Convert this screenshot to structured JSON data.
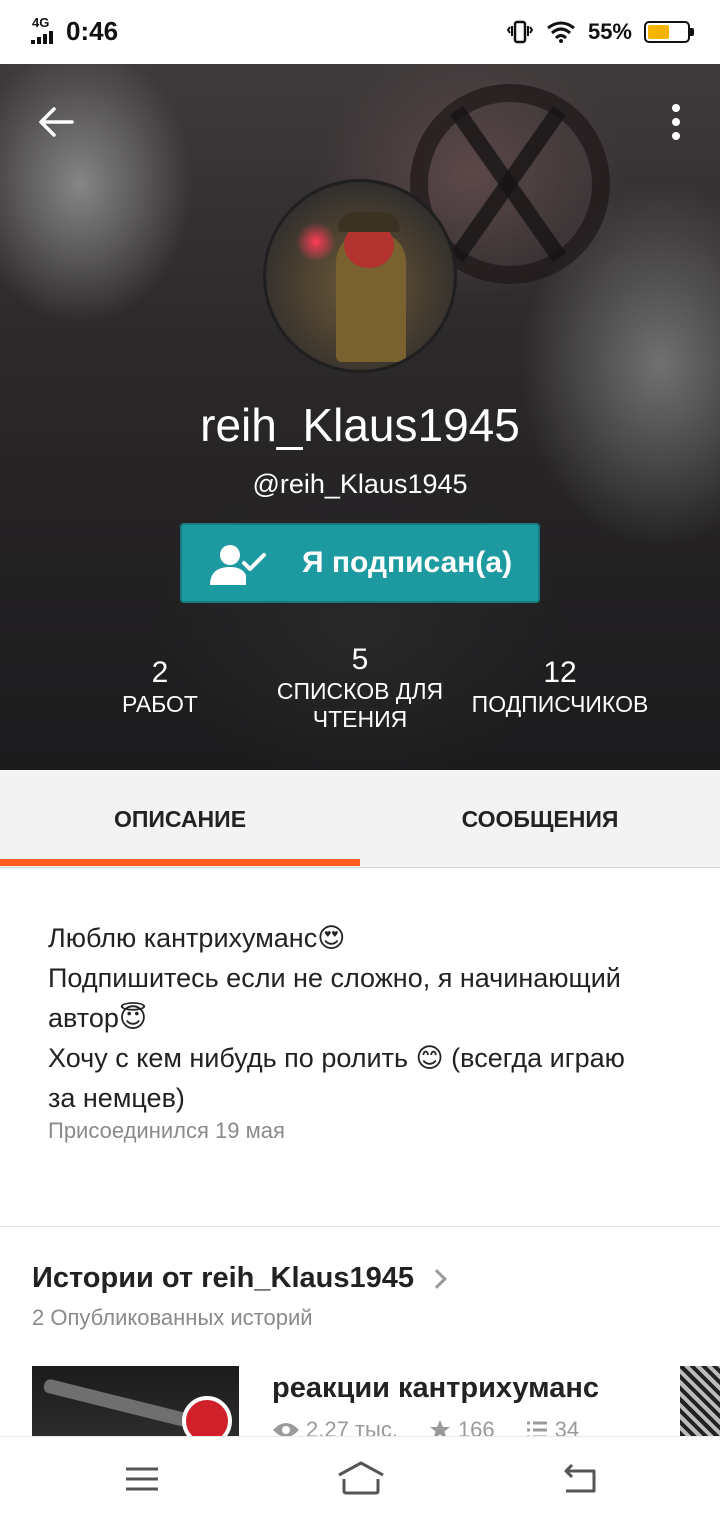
{
  "status_bar": {
    "network": "4G",
    "time": "0:46",
    "battery_percent": "55%",
    "battery_level": 0.55,
    "icons": [
      "signal-icon",
      "vibrate-icon",
      "wifi-icon",
      "battery-icon"
    ]
  },
  "header": {
    "display_name": "reih_Klaus1945",
    "handle": "@reih_Klaus1945",
    "follow_button_label": "Я подписан(а)",
    "stats": {
      "works": {
        "value": "2",
        "label": "РАБОТ"
      },
      "reading_lists": {
        "value": "5",
        "label_line1": "СПИСКОВ ДЛЯ",
        "label_line2": "ЧТЕНИЯ"
      },
      "followers": {
        "value": "12",
        "label": "ПОДПИСЧИКОВ"
      }
    }
  },
  "tabs": [
    {
      "label": "ОПИСАНИЕ",
      "active": true
    },
    {
      "label": "СООБЩЕНИЯ",
      "active": false
    }
  ],
  "description": {
    "lines": [
      "Люблю кантрихуманс😍",
      "Подпишитесь если не сложно, я начинающий",
      "автор😇",
      "Хочу с кем нибудь по ролить 😊 (всегда играю",
      "за немцев)"
    ],
    "joined": "Присоединился 19 мая"
  },
  "stories": {
    "title": "Истории от reih_Klaus1945",
    "subtitle": "2 Опубликованных историй",
    "items": [
      {
        "title": "реакции кантрихуманс",
        "reads": "2,27 тыс.",
        "votes": "166",
        "parts": "34"
      }
    ]
  },
  "colors": {
    "accent": "#ff5a1f",
    "follow_button": "#1c9aa0",
    "battery": "#f5b400"
  }
}
